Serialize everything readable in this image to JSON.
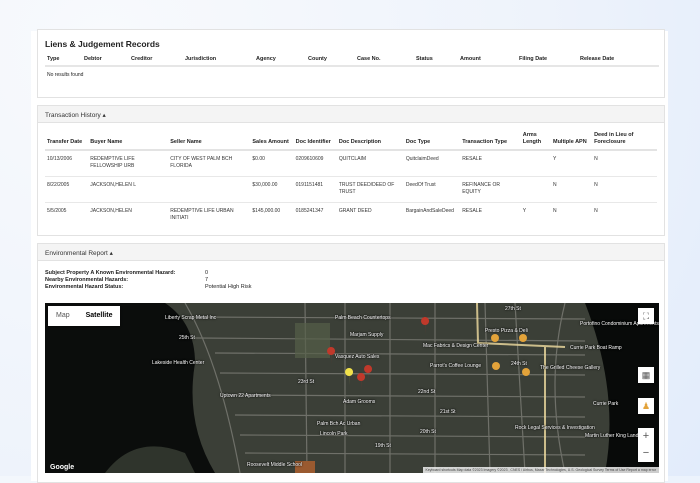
{
  "liens": {
    "title": "Liens & Judgement Records",
    "columns": [
      "Type",
      "Debtor",
      "Creditor",
      "Jurisdiction",
      "Agency",
      "County",
      "Case No.",
      "Status",
      "Amount",
      "Filing Date",
      "Release Date"
    ],
    "empty": "No results found"
  },
  "transactions": {
    "title": "Transaction History ▴",
    "columns": [
      "Transfer Date",
      "Buyer Name",
      "Seller Name",
      "Sales Amount",
      "Doc Identifier",
      "Doc Description",
      "Doc Type",
      "Transaction Type",
      "Arms Length",
      "Multiple APN",
      "Deed in Lieu of Foreclosure"
    ],
    "rows": [
      [
        "10/13/2006",
        "REDEMPTIVE LIFE FELLOWSHIP URB",
        "CITY OF WEST PALM BCH FLORIDA",
        "$0.00",
        "0209610609",
        "QUITCLAIM",
        "QuitclaimDeed",
        "RESALE",
        "",
        "Y",
        "N"
      ],
      [
        "8/22/2005",
        "JACKSON,HELEN L",
        "",
        "$30,000.00",
        "0191151481",
        "TRUST DEED/DEED OF TRUST",
        "DeedOf Trust",
        "REFINANCE OR EQUITY",
        "",
        "N",
        "N"
      ],
      [
        "5/5/2005",
        "JACKSON,HELEN",
        "REDEMPTIVE LIFE URBAN INITIATI",
        "$145,000.00",
        "0185241347",
        "GRANT DEED",
        "BargainAndSaleDeed",
        "RESALE",
        "Y",
        "N",
        "N"
      ]
    ]
  },
  "environmental": {
    "title": "Environmental Report ▴",
    "fields": [
      {
        "label": "Subject Property A Known Environmental Hazard:",
        "value": "0"
      },
      {
        "label": "Nearby Environmental Hazards:",
        "value": "7"
      },
      {
        "label": "Environmental Hazard Status:",
        "value": "Potential High Risk"
      }
    ]
  },
  "map": {
    "map_label": "Map",
    "satellite_label": "Satellite",
    "google": "Google",
    "attribution": "Keyboard shortcuts   Map data ©2023 Imagery ©2023 , CNES / Airbus, Maxar Technologies, U.S. Geological Survey   Terms of Use   Report a map error",
    "labels": [
      "Liberty Scrap Metal Inc",
      "Palm Beach Countertops",
      "Marjam Supply",
      "Lakeside Health Center",
      "Vasquez Auto Sales",
      "Uptown 22 Apartments",
      "Adam Grooms",
      "Palm Bch Ac Urban",
      "Lincoln Park",
      "Roosevelt Middle School",
      "Mac Fabrics & Design Center",
      "Parrot's Coffee Lounge",
      "Presto Pizza & Deli",
      "Portofino Condominium Apartments",
      "Currie Park Boat Ramp",
      "The Grilled Cheese Gallery",
      "Currie Park",
      "Rock Legal Services & Investigation",
      "Martin Luther King Landmark",
      "25th St",
      "23rd St",
      "22nd St",
      "21st St",
      "20th St",
      "19th St",
      "27th St",
      "24th St"
    ]
  }
}
